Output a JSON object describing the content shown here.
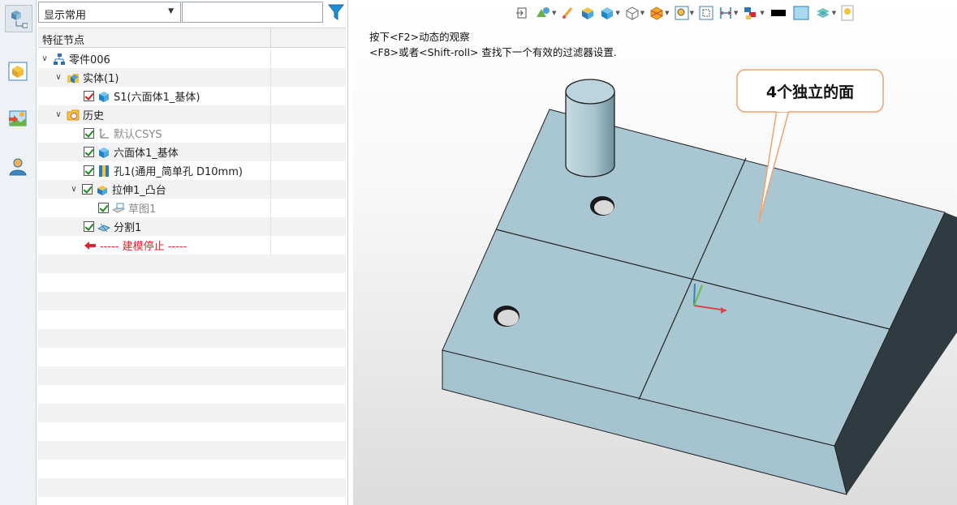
{
  "filter": {
    "selected": "显示常用",
    "search_value": ""
  },
  "tree": {
    "header": "特征节点",
    "nodes": [
      {
        "label": "零件006",
        "icon": "part-assembly-icon"
      },
      {
        "label": "实体(1)",
        "icon": "solid-body-folder-icon"
      },
      {
        "label": "S1(六面体1_基体)",
        "icon": "solid-cube-icon"
      },
      {
        "label": "历史",
        "icon": "history-folder-icon"
      },
      {
        "label": "默认CSYS",
        "icon": "csys-icon"
      },
      {
        "label": "六面体1_基体",
        "icon": "hexahedron-icon"
      },
      {
        "label": "孔1(通用_简单孔 D10mm)",
        "icon": "hole-icon"
      },
      {
        "label": "拉伸1_凸台",
        "icon": "extrude-icon"
      },
      {
        "label": "草图1",
        "icon": "sketch-icon"
      },
      {
        "label": "分割1",
        "icon": "split-icon"
      },
      {
        "label": "----- 建模停止 -----",
        "icon": "stop-arrow-icon"
      }
    ]
  },
  "viewport": {
    "hint_line1": "按下<F2>动态的观察",
    "hint_line2": "<F8>或者<Shift-roll> 查找下一个有效的过滤器设置.",
    "callout": "4个独立的面"
  },
  "toolbar_icons": [
    "exit-icon",
    "render-mode-icon",
    "brush-icon",
    "view-cube-icon",
    "shaded-cube-icon",
    "wireframe-cube-icon",
    "section-icon",
    "zoom-fit-icon",
    "zoom-window-icon",
    "measure-icon",
    "layers-icon",
    "color-black-icon",
    "color-swatch-icon",
    "stack-icon",
    "bulb-icon"
  ],
  "colors": {
    "face": "#a9c7d3",
    "face_front": "#9fc0cc",
    "side_dark": "#2f3b40",
    "callout_border": "#f2a26b",
    "stop_red": "#e0242e"
  }
}
